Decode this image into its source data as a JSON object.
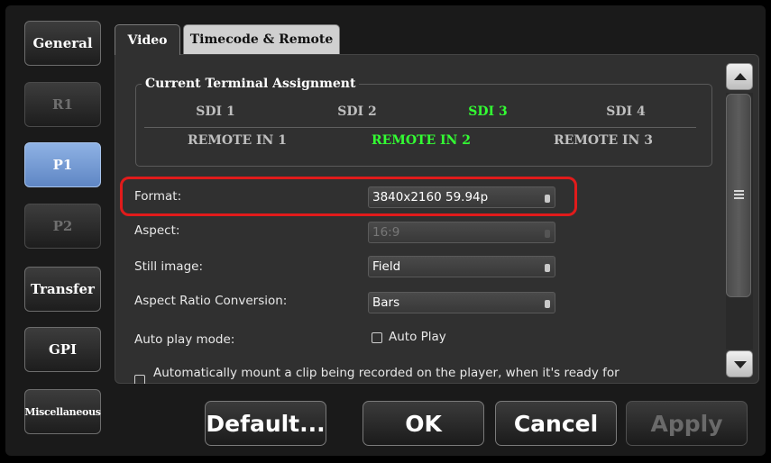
{
  "sidebar": {
    "items": [
      {
        "label": "General",
        "state": "normal"
      },
      {
        "label": "R1",
        "state": "disabled"
      },
      {
        "label": "P1",
        "state": "active"
      },
      {
        "label": "P2",
        "state": "disabled"
      },
      {
        "label": "Transfer",
        "state": "normal"
      },
      {
        "label": "GPI",
        "state": "normal"
      },
      {
        "label": "Miscellaneous",
        "state": "normal"
      }
    ]
  },
  "tabs": [
    {
      "label": "Video",
      "active": true
    },
    {
      "label": "Timecode & Remote",
      "active": false
    }
  ],
  "terminal_assignment": {
    "title": "Current Terminal Assignment",
    "sdi": [
      "SDI 1",
      "SDI 2",
      "SDI 3",
      "SDI 4"
    ],
    "remote": [
      "REMOTE IN 1",
      "REMOTE IN 2",
      "REMOTE IN 3"
    ],
    "active_sdi": "SDI 3",
    "active_remote": "REMOTE IN 2",
    "active_color": "#33ff33"
  },
  "form": {
    "format": {
      "label": "Format:",
      "value": "3840x2160 59.94p"
    },
    "aspect": {
      "label": "Aspect:",
      "value": "16:9",
      "disabled": true
    },
    "still_image": {
      "label": "Still image:",
      "value": "Field"
    },
    "aspect_ratio_conversion": {
      "label": "Aspect Ratio Conversion:",
      "value": "Bars"
    },
    "auto_play_mode": {
      "label": "Auto play mode:",
      "checkbox_label": "Auto Play",
      "checked": false
    },
    "auto_mount": {
      "label": "Automatically mount a clip being recorded on the player, when it's ready for",
      "checked": false
    }
  },
  "highlight_color": "#e11b1b",
  "buttons": {
    "default": "Default...",
    "ok": "OK",
    "cancel": "Cancel",
    "apply": "Apply"
  }
}
